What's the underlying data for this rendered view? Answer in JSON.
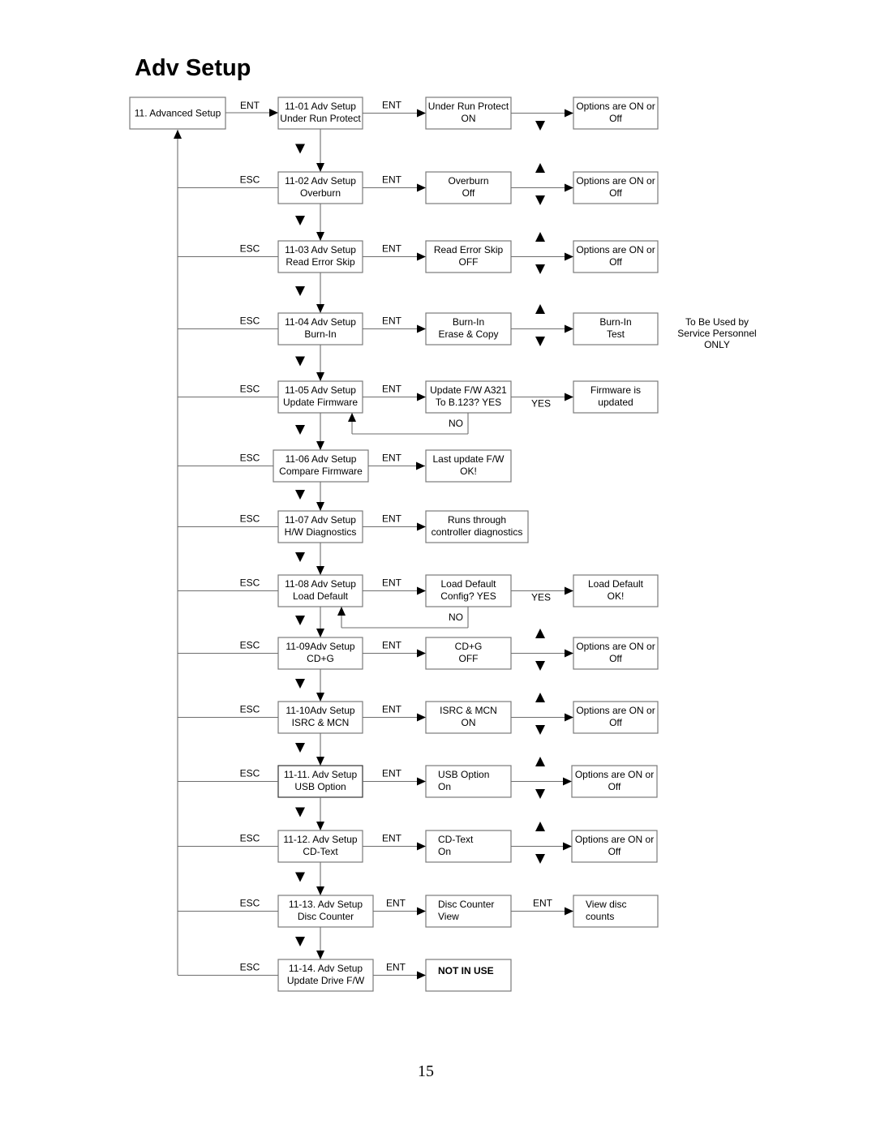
{
  "title": "Adv Setup",
  "page_number": "15",
  "root": {
    "label": "11. Advanced Setup"
  },
  "labels": {
    "ent": "ENT",
    "esc": "ESC",
    "yes": "YES",
    "no": "NO"
  },
  "side_note": [
    "To Be Used by",
    "Service Personnel",
    "ONLY"
  ],
  "rows": [
    {
      "id": "11-01",
      "menu": [
        "11-01 Adv Setup",
        "Under Run Protect"
      ],
      "value": [
        "Under Run Protect",
        "ON"
      ],
      "result": [
        "Options are ON or",
        "Off"
      ],
      "result_link": "updown",
      "has_up": false
    },
    {
      "id": "11-02",
      "menu": [
        "11-02 Adv Setup",
        "Overburn"
      ],
      "value": [
        "Overburn",
        "Off"
      ],
      "result": [
        "Options are ON or",
        "Off"
      ],
      "result_link": "updown",
      "has_up": true
    },
    {
      "id": "11-03",
      "menu": [
        "11-03 Adv Setup",
        "Read Error Skip"
      ],
      "value": [
        "Read Error Skip",
        "OFF"
      ],
      "result": [
        "Options are ON or",
        "Off"
      ],
      "result_link": "updown",
      "has_up": true
    },
    {
      "id": "11-04",
      "menu": [
        "11-04 Adv Setup",
        "Burn-In"
      ],
      "value": [
        "Burn-In",
        "Erase & Copy"
      ],
      "result": [
        "Burn-In",
        "Test"
      ],
      "result_link": "updown",
      "has_up": true,
      "note": true
    },
    {
      "id": "11-05",
      "menu": [
        "11-05 Adv Setup",
        "Update Firmware"
      ],
      "value": [
        "Update F/W A321",
        "To B.123?  YES"
      ],
      "result": [
        "Firmware is",
        "updated"
      ],
      "result_link": "yes",
      "no_loop": true
    },
    {
      "id": "11-06",
      "menu": [
        "11-06 Adv Setup",
        "Compare Firmware"
      ],
      "value": [
        "Last update F/W",
        "OK!"
      ],
      "result": null
    },
    {
      "id": "11-07",
      "menu": [
        "11-07 Adv Setup",
        "H/W Diagnostics"
      ],
      "value": [
        "Runs through",
        "controller diagnostics"
      ],
      "result": null
    },
    {
      "id": "11-08",
      "menu": [
        "11-08 Adv Setup",
        "Load Default"
      ],
      "value": [
        "Load Default",
        "Config? YES"
      ],
      "result": [
        "Load Default",
        "OK!"
      ],
      "result_link": "yes",
      "no_loop": true
    },
    {
      "id": "11-09",
      "menu": [
        "11-09Adv Setup",
        "CD+G"
      ],
      "value": [
        "CD+G",
        "OFF"
      ],
      "result": [
        "Options are ON or",
        "Off"
      ],
      "result_link": "updown",
      "has_up": true
    },
    {
      "id": "11-10",
      "menu": [
        "11-10Adv Setup",
        "ISRC & MCN"
      ],
      "value": [
        "ISRC & MCN",
        "ON"
      ],
      "result": [
        "Options are ON or",
        "Off"
      ],
      "result_link": "updown",
      "has_up": true
    },
    {
      "id": "11-11",
      "menu": [
        "11-11. Adv Setup",
        "USB Option"
      ],
      "value": [
        "USB Option",
        "On"
      ],
      "result": [
        "Options are ON or",
        "Off"
      ],
      "result_link": "updown",
      "has_up": true
    },
    {
      "id": "11-12",
      "menu": [
        "11-12. Adv Setup",
        "CD-Text"
      ],
      "value": [
        "CD-Text",
        "On"
      ],
      "result": [
        "Options are ON or",
        "Off"
      ],
      "result_link": "updown",
      "has_up": true
    },
    {
      "id": "11-13",
      "menu": [
        "11-13. Adv Setup",
        "Disc Counter"
      ],
      "value": [
        "Disc Counter",
        "View"
      ],
      "result": [
        "View disc",
        "counts"
      ],
      "result_link": "ent"
    },
    {
      "id": "11-14",
      "menu": [
        "11-14. Adv Setup",
        "Update Drive F/W"
      ],
      "value": [
        "NOT IN USE"
      ],
      "value_bold": true,
      "result": null
    }
  ]
}
